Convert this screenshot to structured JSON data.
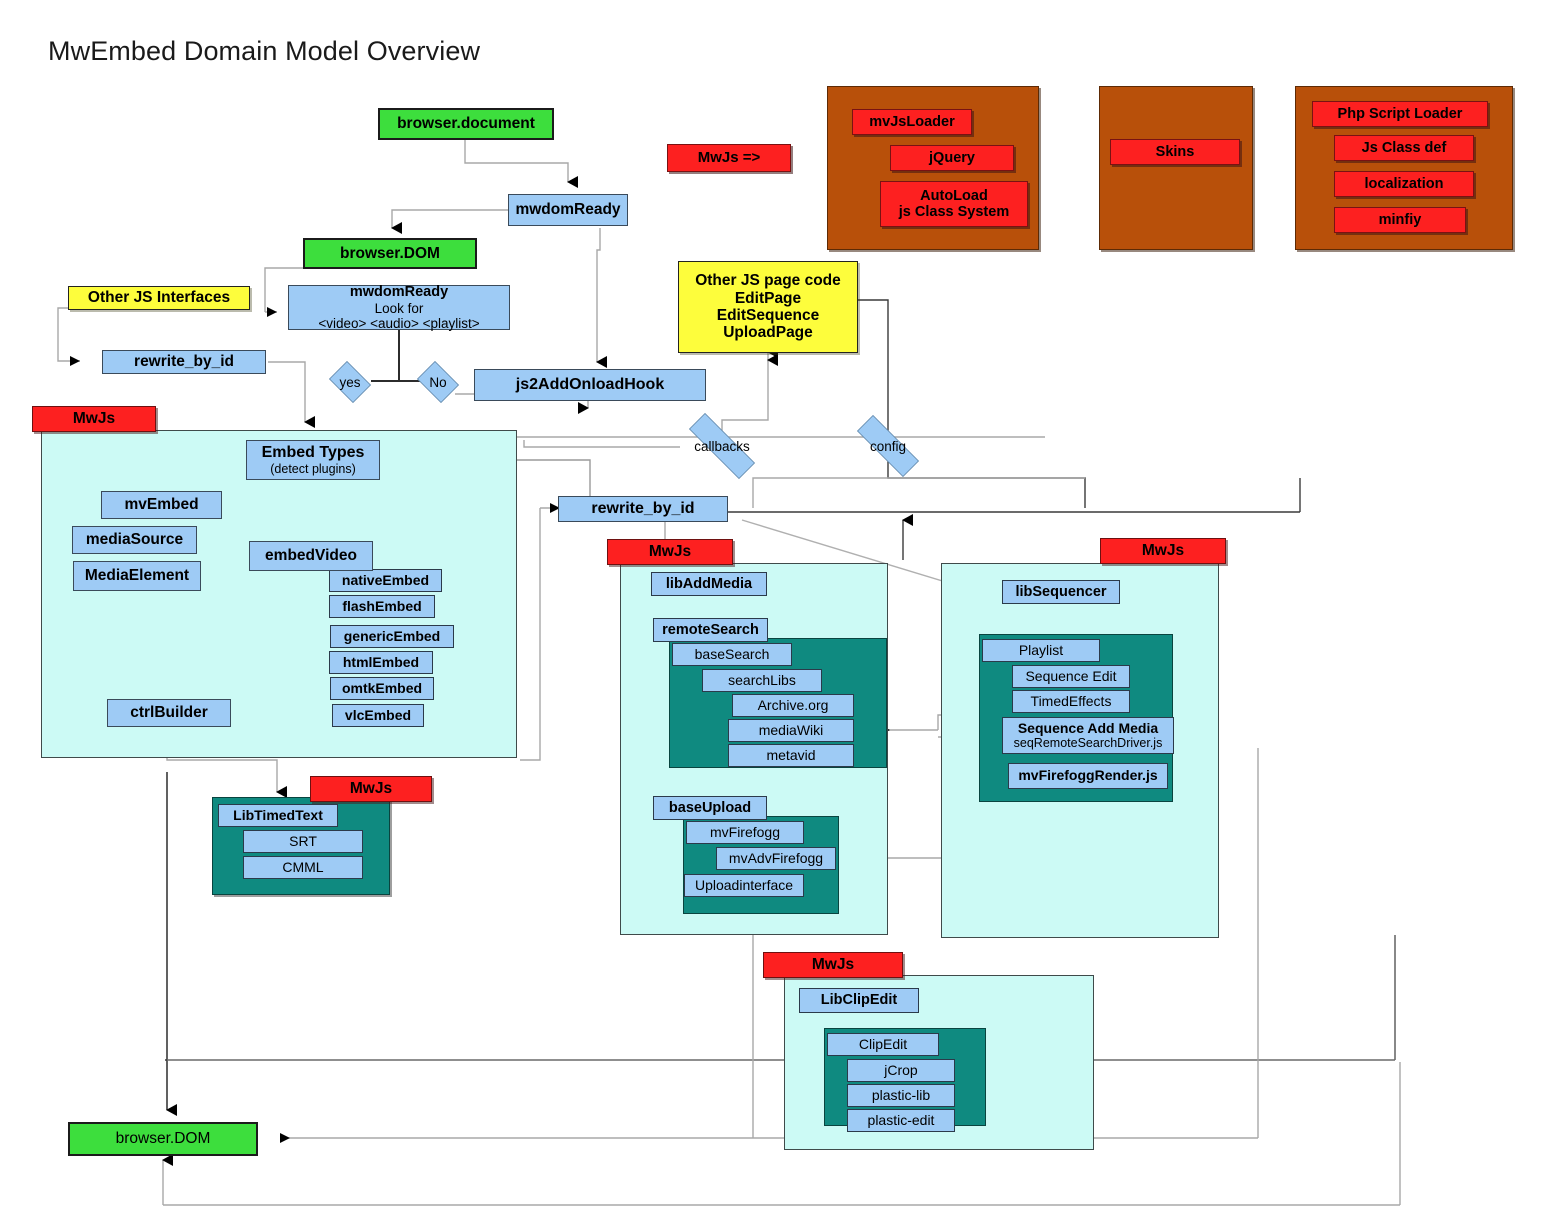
{
  "title": "MwEmbed Domain Model Overview",
  "nodes": {
    "browser_document": "browser.document",
    "mwdomready_top": "mwdomReady",
    "browser_dom_top": "browser.DOM",
    "other_js_interfaces": "Other JS Interfaces",
    "mwdomready_detail_line1": "mwdomReady",
    "mwdomready_detail_line2": "Look for",
    "mwdomready_detail_line3": "<video> <audio> <playlist>",
    "rewrite_by_id_left": "rewrite_by_id",
    "yes_diamond": "yes",
    "no_diamond": "No",
    "js2addonloadhook": "js2AddOnloadHook",
    "other_js_page_code_line1": "Other JS page code",
    "other_js_page_code_line2": "EditPage",
    "other_js_page_code_line3": "EditSequence",
    "other_js_page_code_line4": "UploadPage",
    "callbacks_diamond": "callbacks",
    "config_diamond": "config",
    "rewrite_by_id_mid": "rewrite_by_id",
    "browser_dom_bottom": "browser.DOM"
  },
  "loader_row": {
    "mwjs_entry": "MwJs =>",
    "group_mvjsloader": {
      "items": [
        "mvJsLoader",
        "jQuery",
        "AutoLoad\njs Class System"
      ]
    },
    "group_skins": {
      "items": [
        "Skins"
      ]
    },
    "group_php": {
      "items": [
        "Php Script Loader",
        "Js Class def",
        "localization",
        "minfiy"
      ]
    }
  },
  "mwjs_labels": {
    "embed_panel": "MwJs",
    "timedtext_panel": "MwJs",
    "addmedia_panel": "MwJs",
    "sequencer_panel": "MwJs",
    "clipedit_panel": "MwJs"
  },
  "embed_panel": {
    "embed_types_line1": "Embed Types",
    "embed_types_line2": "(detect plugins)",
    "mvembed": "mvEmbed",
    "mediasource": "mediaSource",
    "mediaelement": "MediaElement",
    "embedvideo": "embedVideo",
    "ctrlbuilder": "ctrlBuilder",
    "embed_impls": [
      "nativeEmbed",
      "flashEmbed",
      "genericEmbed",
      "htmlEmbed",
      "omtkEmbed",
      "vlcEmbed"
    ]
  },
  "timedtext_group": {
    "head": "LibTimedText",
    "items": [
      "SRT",
      "CMML"
    ]
  },
  "addmedia_panel": {
    "libaddmedia": "libAddMedia",
    "remotesearch": "remoteSearch",
    "basesearch": "baseSearch",
    "searchlibs": "searchLibs",
    "search_sources": [
      "Archive.org",
      "mediaWiki",
      "metavid"
    ],
    "baseupload": "baseUpload",
    "mvfirefogg": "mvFirefogg",
    "mvadvfirefogg": "mvAdvFirefogg",
    "uploadinterface": "Uploadinterface"
  },
  "sequencer_panel": {
    "libsequencer": "libSequencer",
    "playlist": "Playlist",
    "sequence_edit": "Sequence Edit",
    "timedeffects": "TimedEffects",
    "sequence_add_media_line1": "Sequence Add Media",
    "sequence_add_media_line2": "seqRemoteSearchDriver.js",
    "mvfirefoggrender": "mvFirefoggRender.js"
  },
  "clipedit_panel": {
    "libclipedit": "LibClipEdit",
    "clipedit": "ClipEdit",
    "items": [
      "jCrop",
      "plastic-lib",
      "plastic-edit"
    ]
  },
  "colors": {
    "green": "#3dde3d",
    "blue": "#9ecbf5",
    "red": "#fd2020",
    "brown": "#b8500a",
    "yellow": "#fdfd3c",
    "cyan_panel": "#ccfaf5",
    "teal_group": "#0f8a80",
    "wire": "#9a9a9a",
    "wire_dark": "#3a3a3a"
  }
}
